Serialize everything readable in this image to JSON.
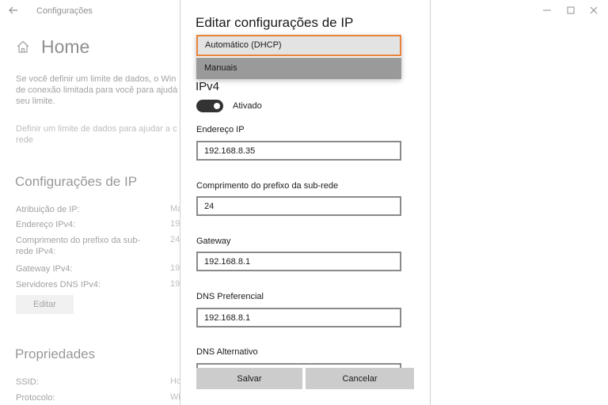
{
  "window": {
    "title": "Configurações",
    "controls": [
      "minimize-icon",
      "maximize-icon",
      "close-icon"
    ]
  },
  "page": {
    "title": "Home",
    "data_limit_text": "Se você definir um limite de dados, o Win de conexão limitada para você para ajudá seu limite.",
    "data_limit_link": "Definir um limite de dados para ajudar a c rede"
  },
  "ip_settings": {
    "heading": "Configurações de IP",
    "rows": [
      {
        "label": "Atribuição de IP:",
        "value": "Ma"
      },
      {
        "label": "Endereço IPv4:",
        "value": "192"
      },
      {
        "label": "Comprimento do prefixo da sub-rede IPv4:",
        "value": "24"
      },
      {
        "label": "Gateway IPv4:",
        "value": "192"
      },
      {
        "label": "Servidores DNS IPv4:",
        "value": "192"
      }
    ],
    "edit_label": "Editar"
  },
  "properties": {
    "heading": "Propriedades",
    "rows": [
      {
        "label": "SSID:",
        "value": "Ho"
      },
      {
        "label": "Protocolo:",
        "value": "Wi"
      }
    ]
  },
  "dialog": {
    "title": "Editar configurações de IP",
    "dropdown": {
      "options": [
        "Automático (DHCP)",
        "Manuais"
      ],
      "selected": "Automático (DHCP)",
      "hovered": "Manuais"
    },
    "ipv4_heading": "IPv4",
    "toggle": {
      "label": "Ativado",
      "on": true
    },
    "fields": {
      "ip_address": {
        "label": "Endereço IP",
        "value": "192.168.8.35"
      },
      "prefix_length": {
        "label": "Comprimento do prefixo da sub-rede",
        "value": "24"
      },
      "gateway": {
        "label": "Gateway",
        "value": "192.168.8.1"
      },
      "dns_preferred": {
        "label": "DNS Preferencial",
        "value": "192.168.8.1"
      },
      "dns_alternate": {
        "label": "DNS Alternativo",
        "value": ""
      }
    },
    "save_label": "Salvar",
    "cancel_label": "Cancelar"
  },
  "colors": {
    "focus_border": "#e8833a",
    "toggle_on": "#333333",
    "button_bg": "#cccccc"
  }
}
